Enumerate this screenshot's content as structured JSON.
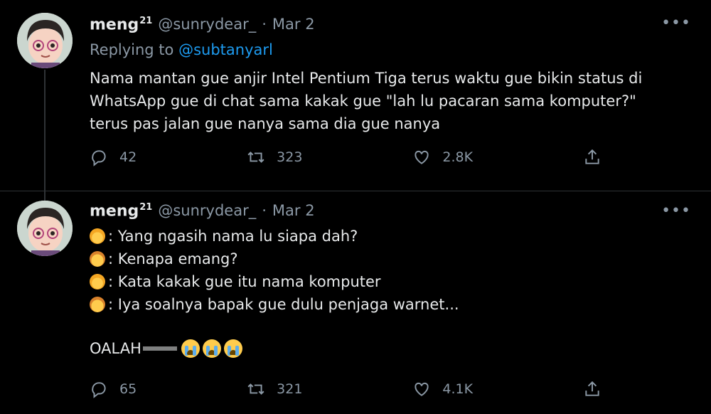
{
  "tweets": [
    {
      "name": "meng",
      "name_sup": "21",
      "handle": "@sunrydear_",
      "dot": "·",
      "date": "Mar 2",
      "replying_prefix": "Replying to",
      "replying_to": "@subtanyarl",
      "text_lines": [
        "Nama mantan gue anjir Intel Pentium Tiga terus waktu gue bikin status di",
        "WhatsApp gue di chat sama kakak gue \"lah lu pacaran sama komputer?\"",
        "terus pas jalan gue nanya sama dia gue nanya"
      ],
      "stats": {
        "replies": "42",
        "retweets": "323",
        "likes": "2.8K"
      }
    },
    {
      "name": "meng",
      "name_sup": "21",
      "handle": "@sunrydear_",
      "dot": "·",
      "date": "Mar 2",
      "text_lines": [
        ": Yang ngasih nama lu siapa dah?",
        ": Kenapa emang?",
        ": Kata kakak gue itu nama komputer",
        ": Iya soalnya bapak gue dulu penjaga warnet..."
      ],
      "closing": "OALAH",
      "stats": {
        "replies": "65",
        "retweets": "321",
        "likes": "4.1K"
      }
    }
  ],
  "more_label": "•••",
  "icons": [
    "reply-icon",
    "retweet-icon",
    "like-icon",
    "share-icon",
    "more-icon"
  ],
  "colors": {
    "background": "#000000",
    "secondary": "#8b98a5",
    "link": "#1d9bf0"
  }
}
